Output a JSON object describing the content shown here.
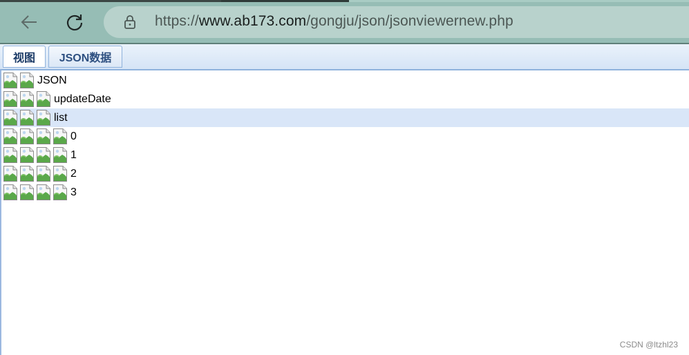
{
  "browser": {
    "url_prefix": "https://",
    "url_host": "www.ab173.com",
    "url_path": "/gongju/json/jsonviewernew.php",
    "back_icon": "arrow-left-icon",
    "reload_icon": "reload-icon",
    "lock_icon": "lock-icon"
  },
  "tabs": [
    {
      "label": "视图",
      "active": true
    },
    {
      "label": "JSON数据",
      "active": false
    }
  ],
  "tree": {
    "root": {
      "label": "JSON",
      "icon_count": 2
    },
    "rows": [
      {
        "label": "updateDate",
        "icon_count": 3,
        "selected": false
      },
      {
        "label": "list",
        "icon_count": 3,
        "selected": true
      },
      {
        "label": "0",
        "icon_count": 4,
        "selected": false
      },
      {
        "label": "1",
        "icon_count": 4,
        "selected": false
      },
      {
        "label": "2",
        "icon_count": 4,
        "selected": false
      },
      {
        "label": "3",
        "icon_count": 4,
        "selected": false
      }
    ],
    "icon": "broken-image-icon"
  },
  "watermark": "CSDN @ltzhl23",
  "colors": {
    "browser_bar": "#96bdb5",
    "address_bar": "#b8d2cc",
    "tab_border": "#8fb2dc",
    "selected_row": "#d9e6f8"
  }
}
